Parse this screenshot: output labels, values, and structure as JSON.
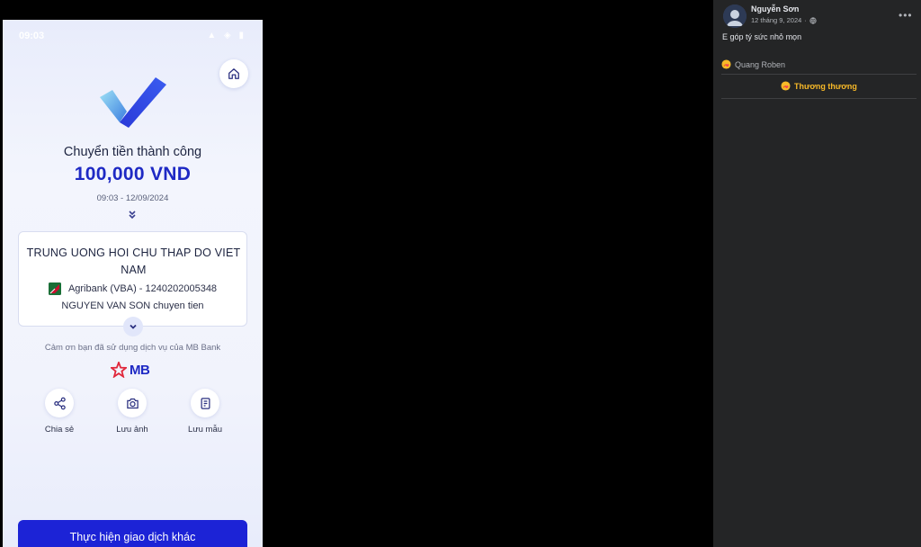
{
  "phone": {
    "status_time": "09:03",
    "title": "Chuyển tiền thành công",
    "amount": "100,000 VND",
    "datetime": "09:03 - 12/09/2024",
    "recipient_name": "TRUNG UONG HOI CHU THAP DO VIET NAM",
    "bank_account": "Agribank (VBA) - 1240202005348",
    "memo": "NGUYEN VAN SON chuyen tien",
    "thanks": "Cảm ơn bạn đã sử dụng dịch vụ của MB Bank",
    "brand": "MB",
    "actions": [
      {
        "label": "Chia sẻ",
        "icon": "share-icon"
      },
      {
        "label": "Lưu ảnh",
        "icon": "camera-icon"
      },
      {
        "label": "Lưu mẫu",
        "icon": "template-icon"
      }
    ],
    "primary_button": "Thực hiện giao dịch khác",
    "colors": {
      "brand_blue": "#1e29c4",
      "button_blue": "#1c23d6",
      "brand_red": "#e0263a"
    }
  },
  "comment": {
    "author": "Nguyễn Sơn",
    "date": "12 tháng 9, 2024",
    "text": "E góp tý sức nhỏ mọn",
    "reactor": "Quang Roben",
    "reaction_button": "Thương thương",
    "colors": {
      "panel_bg": "#242526",
      "reaction": "#f7b928"
    }
  }
}
